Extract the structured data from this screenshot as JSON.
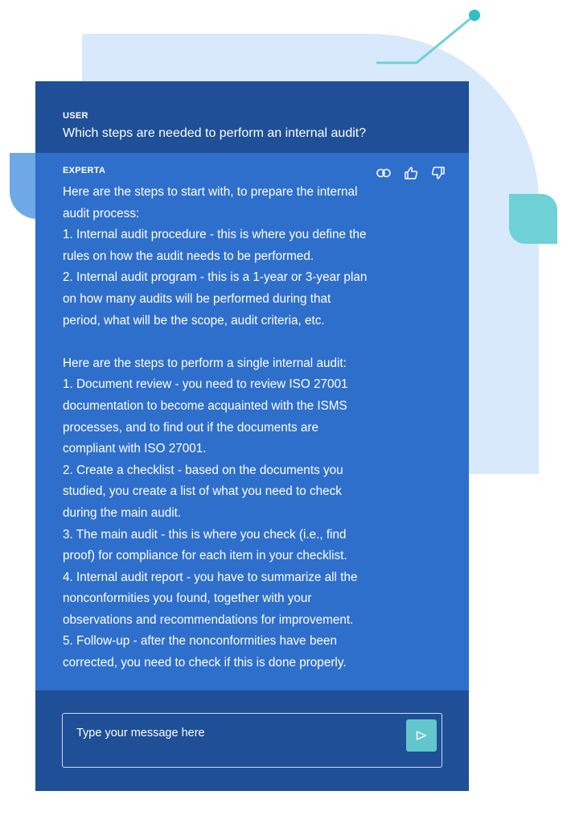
{
  "user": {
    "role": "USER",
    "message": "Which steps are needed to perform an internal audit?"
  },
  "assistant": {
    "role": "EXPERTA",
    "lines": [
      "Here are the steps to start with, to prepare the internal",
      "audit process:",
      "1. Internal audit procedure - this is where you define the",
      "rules on how the audit needs to be performed.",
      "2. Internal audit program - this is a 1-year or 3-year plan",
      "on how many audits will be performed during that",
      "period, what will be the scope, audit criteria, etc.",
      "",
      "Here are the steps to perform a single internal audit:",
      "1. Document review - you need to review ISO 27001",
      "documentation to become acquainted with the ISMS",
      "processes, and to find out if the documents are",
      "compliant with ISO 27001.",
      "2. Create a checklist - based on the documents you",
      "studied, you create a list of what you need to check",
      "during the main audit.",
      "3. The main audit - this is where you check (i.e., find",
      "proof) for compliance for each item in your checklist.",
      "4. Internal audit report - you have to summarize all the",
      "nonconformities you found, together with your",
      "observations and recommendations for improvement.",
      "5. Follow-up - after the nonconformities have been",
      "corrected, you need to check if this is done properly."
    ],
    "actions": [
      "link-icon",
      "thumbs-up-icon",
      "thumbs-down-icon"
    ]
  },
  "composer": {
    "placeholder": "Type your message here",
    "value": "",
    "send_icon": "send-icon"
  },
  "colors": {
    "user_bg": "#1f4f96",
    "assistant_bg": "#2f6fcc",
    "accent_teal": "#63c6cc",
    "backdrop": "#d7e9fb"
  }
}
